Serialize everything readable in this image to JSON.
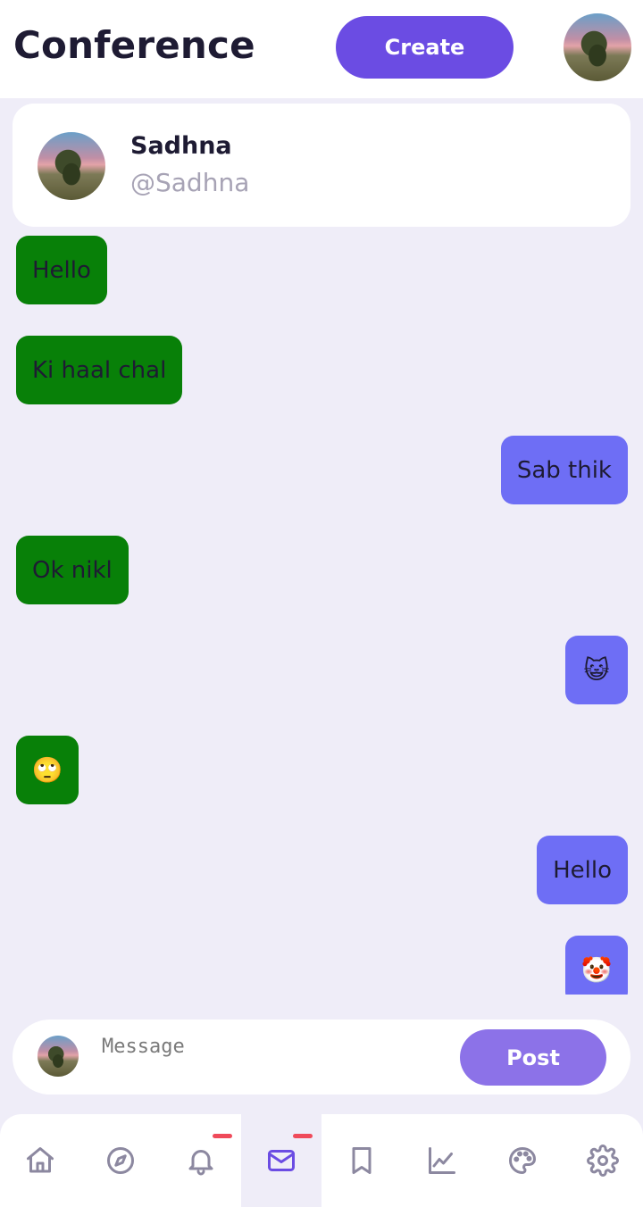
{
  "header": {
    "title": "Conference",
    "create_label": "Create",
    "profile_avatar_icon": "profile-avatar"
  },
  "contact": {
    "name": "Sadhna",
    "handle": "@Sadhna"
  },
  "messages": [
    {
      "direction": "incoming",
      "text": "Hello"
    },
    {
      "direction": "incoming",
      "text": "Ki haal chal"
    },
    {
      "direction": "outgoing",
      "text": "Sab thik"
    },
    {
      "direction": "incoming",
      "text": "Ok nikl"
    },
    {
      "direction": "outgoing",
      "text": "😺"
    },
    {
      "direction": "incoming",
      "text": "🙄"
    },
    {
      "direction": "outgoing",
      "text": "Hello"
    },
    {
      "direction": "outgoing",
      "text": "🤡"
    }
  ],
  "composer": {
    "placeholder": "Message",
    "value": "",
    "post_label": "Post"
  },
  "nav": {
    "items": [
      {
        "icon": "home-icon",
        "active": false,
        "badge": false
      },
      {
        "icon": "compass-icon",
        "active": false,
        "badge": false
      },
      {
        "icon": "bell-icon",
        "active": false,
        "badge": true
      },
      {
        "icon": "mail-icon",
        "active": true,
        "badge": true
      },
      {
        "icon": "bookmark-icon",
        "active": false,
        "badge": false
      },
      {
        "icon": "chart-line-icon",
        "active": false,
        "badge": false
      },
      {
        "icon": "palette-icon",
        "active": false,
        "badge": false
      },
      {
        "icon": "settings-gear-icon",
        "active": false,
        "badge": false
      }
    ]
  },
  "colors": {
    "accent": "#6b4ce3",
    "incoming_bubble": "#088008",
    "outgoing_bubble": "#6e6ef5",
    "background": "#efedf8",
    "badge": "#ef4a5a",
    "nav_icon": "#8c88a0",
    "nav_icon_active": "#6b4ce3"
  }
}
